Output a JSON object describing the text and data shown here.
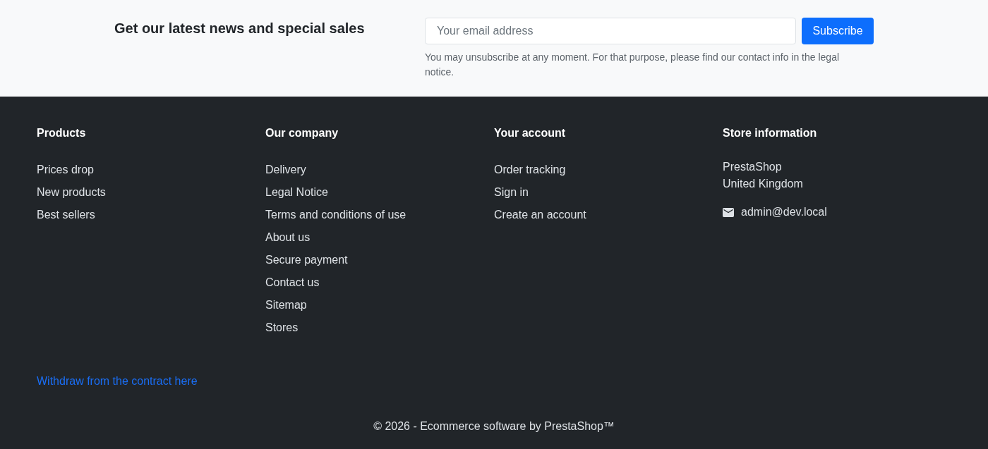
{
  "newsletter": {
    "heading": "Get our latest news and special sales",
    "email_field": {
      "placeholder": "Your email address"
    },
    "subscribe_button": "Subscribe",
    "notice": "You may unsubscribe at any moment. For that purpose, please find our contact info in the legal notice."
  },
  "footer": {
    "columns": [
      {
        "title": "Products",
        "links": [
          "Prices drop",
          "New products",
          "Best sellers"
        ]
      },
      {
        "title": "Our company",
        "links": [
          "Delivery",
          "Legal Notice",
          "Terms and conditions of use",
          "About us",
          "Secure payment",
          "Contact us",
          "Sitemap",
          "Stores"
        ]
      },
      {
        "title": "Your account",
        "links": [
          "Order tracking",
          "Sign in",
          "Create an account"
        ]
      }
    ],
    "store_information": {
      "title": "Store information",
      "address_lines": [
        "PrestaShop",
        "United Kingdom"
      ],
      "email": "admin@dev.local"
    },
    "withdraw_link": "Withdraw from the contract here",
    "copyright": "© 2026 - Ecommerce software by PrestaShop™"
  }
}
